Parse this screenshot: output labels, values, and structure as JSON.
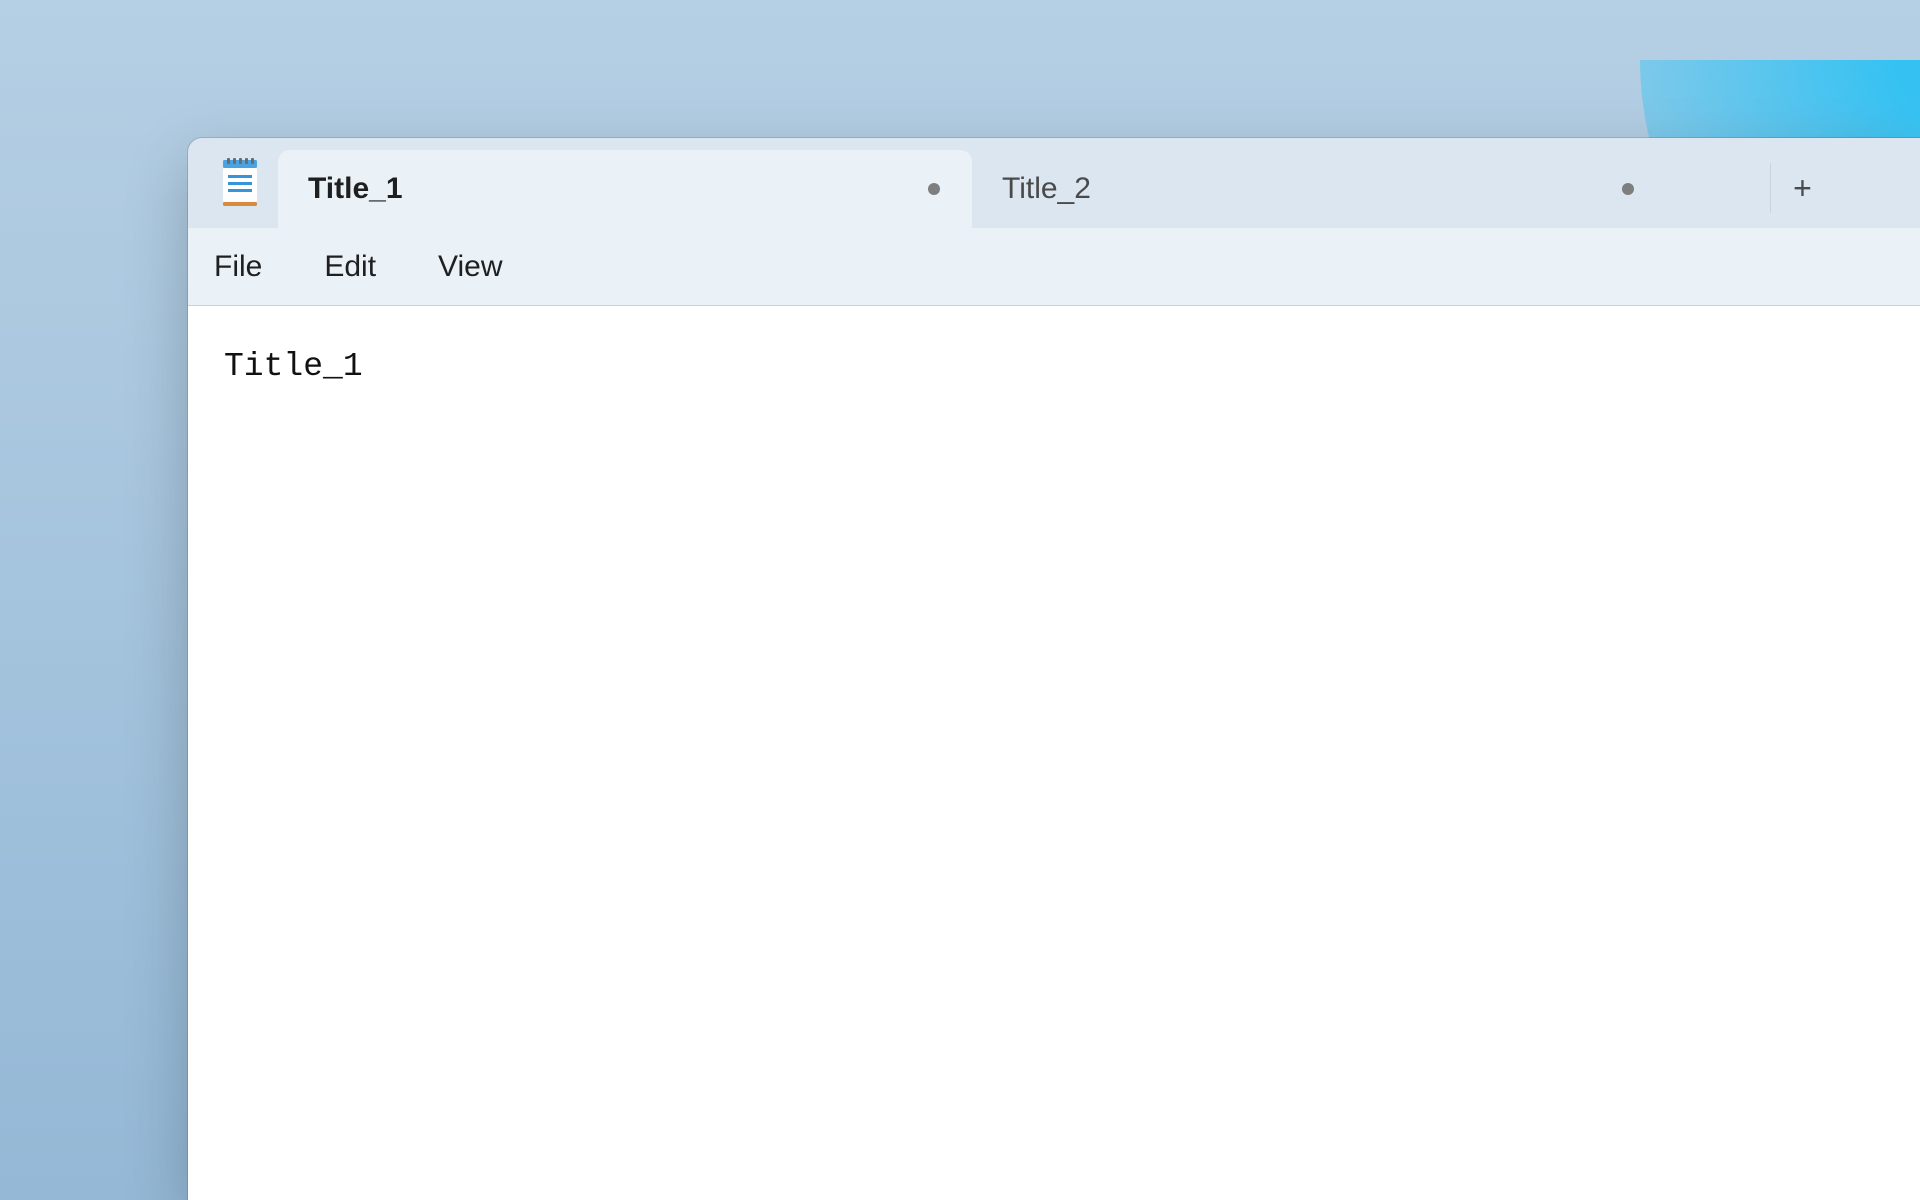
{
  "tabs": [
    {
      "label": "Title_1",
      "active": true,
      "dirty": true
    },
    {
      "label": "Title_2",
      "active": false,
      "dirty": true
    }
  ],
  "menubar": {
    "file": "File",
    "edit": "Edit",
    "view": "View"
  },
  "editor": {
    "content": "Title_1"
  },
  "icons": {
    "app": "notepad-icon",
    "plus": "+"
  }
}
